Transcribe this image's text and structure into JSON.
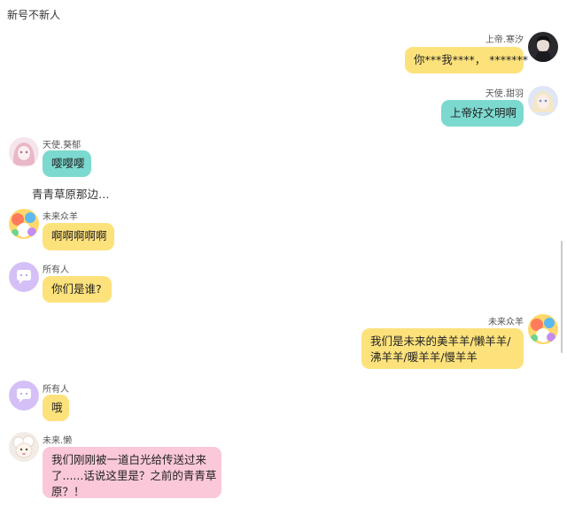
{
  "chat": {
    "title": "新号不新人"
  },
  "messages": [
    {
      "sender": "上帝.寒汐",
      "text": "你***我****， *******",
      "side": "right",
      "color": "#fde27c",
      "avatar_icon": "dark-haired-girl-avatar"
    },
    {
      "sender": "天使.甜羽",
      "text": "上帝好文明啊",
      "side": "right",
      "color": "#7cd9cf",
      "avatar_icon": "blonde-girl-avatar"
    },
    {
      "sender": "天使.葵郁",
      "text": "嘤嘤嘤",
      "side": "left",
      "color": "#7cd9cf",
      "avatar_icon": "pink-girl-avatar"
    },
    {
      "text": "青青草原那边…",
      "side": "left",
      "type": "plain"
    },
    {
      "sender": "未来众羊",
      "text": "啊啊啊啊啊",
      "side": "left",
      "color": "#fde27c",
      "avatar_icon": "colorful-group-avatar"
    },
    {
      "sender": "所有人",
      "text": "你们是谁?",
      "side": "left",
      "color": "#fde27c",
      "avatar_icon": "chat-bubble-avatar"
    },
    {
      "sender": "未来众羊",
      "lines": [
        "我们是未来的美羊羊/懒羊羊/",
        "沸羊羊/暖羊羊/慢羊羊"
      ],
      "side": "right",
      "color": "#fde27c",
      "avatar_icon": "colorful-group-avatar"
    },
    {
      "sender": "所有人",
      "text": "哦",
      "side": "left",
      "color": "#fde27c",
      "avatar_icon": "chat-bubble-avatar"
    },
    {
      "sender": "未来.懒",
      "lines": [
        "我们刚刚被一道白光给传送过来",
        "了......话说这里是？之前的青青草",
        "原？！"
      ],
      "side": "left",
      "color": "#fbc8d9",
      "avatar_icon": "sheep-avatar"
    }
  ]
}
